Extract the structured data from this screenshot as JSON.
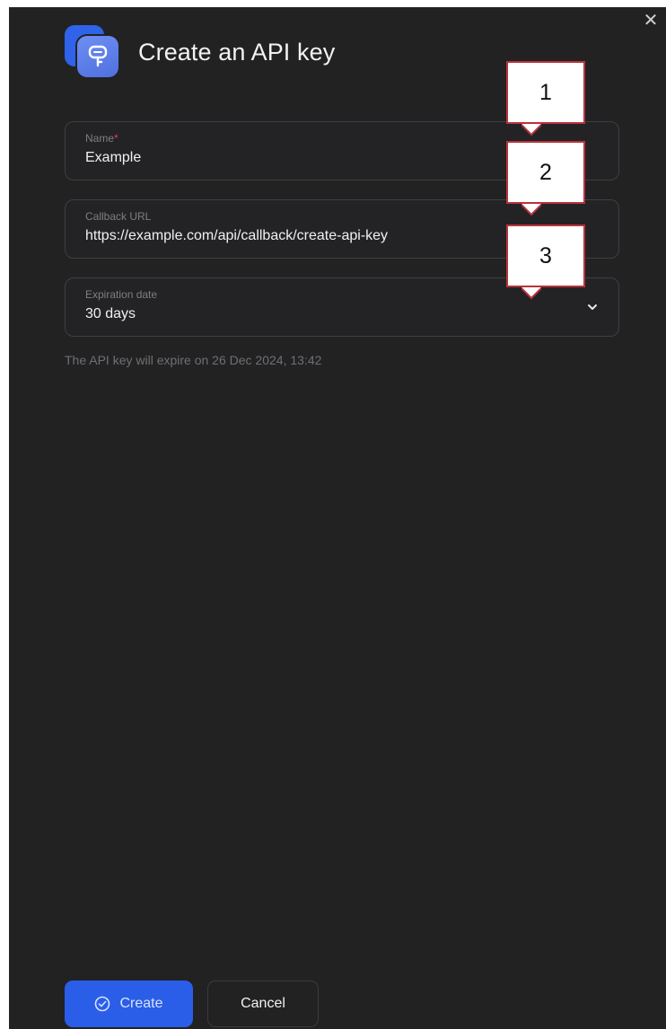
{
  "dialog": {
    "title": "Create an API key",
    "close_icon": "close-icon",
    "app_icon": "key-icon",
    "accent_color": "#2a5ee8"
  },
  "form": {
    "name": {
      "label": "Name",
      "required_mark": "*",
      "value": "Example"
    },
    "callback_url": {
      "label": "Callback URL",
      "value": "https://example.com/api/callback/create-api-key"
    },
    "expiration": {
      "label": "Expiration date",
      "value": "30 days",
      "icon": "chevron-down-icon"
    },
    "expiry_hint": "The API key will expire on 26 Dec 2024, 13:42"
  },
  "callouts": [
    "1",
    "2",
    "3"
  ],
  "actions": {
    "create_label": "Create",
    "create_icon": "check-circle-icon",
    "cancel_label": "Cancel"
  }
}
